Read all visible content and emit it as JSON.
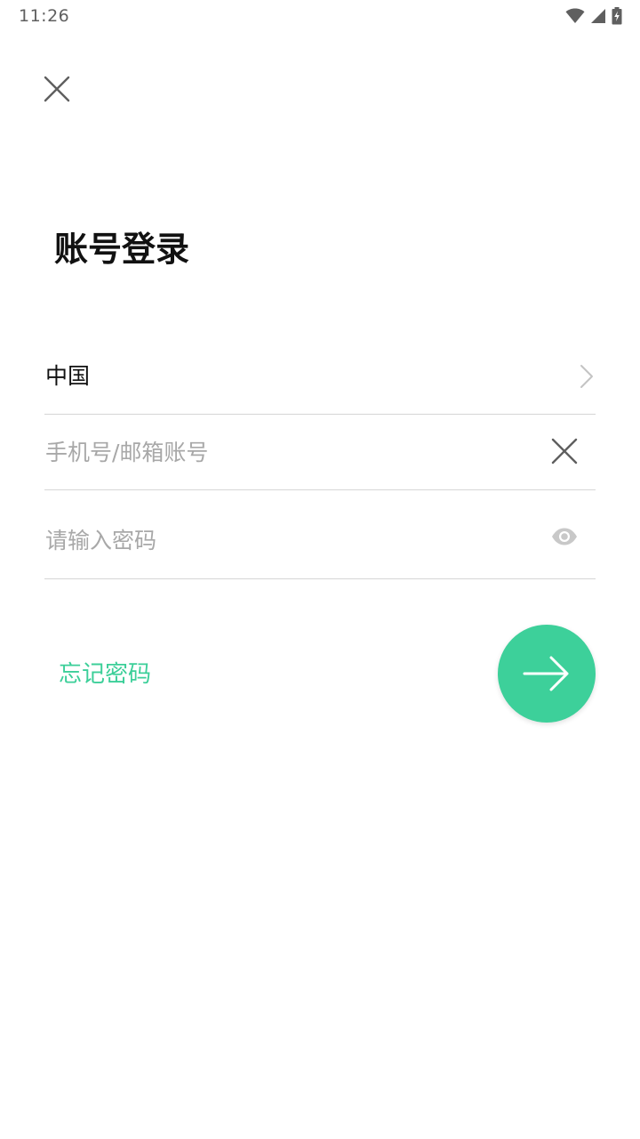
{
  "status_bar": {
    "time": "11:26",
    "icons": [
      "wifi-icon",
      "signal-icon",
      "battery-charging-icon"
    ]
  },
  "header": {
    "close_icon": "close-icon"
  },
  "title": "账号登录",
  "form": {
    "country": {
      "value": "中国",
      "icon": "chevron-right-icon"
    },
    "account": {
      "value": "",
      "placeholder": "手机号/邮箱账号",
      "clear_icon": "close-icon"
    },
    "password": {
      "value": "",
      "placeholder": "请输入密码",
      "visibility_icon": "eye-icon"
    }
  },
  "actions": {
    "forgot_password": "忘记密码",
    "submit_icon": "arrow-right-icon"
  },
  "colors": {
    "accent": "#3dd09a",
    "divider": "#d6d6d6",
    "placeholder": "#a8a8a8",
    "icon": "#5f5f5f"
  }
}
